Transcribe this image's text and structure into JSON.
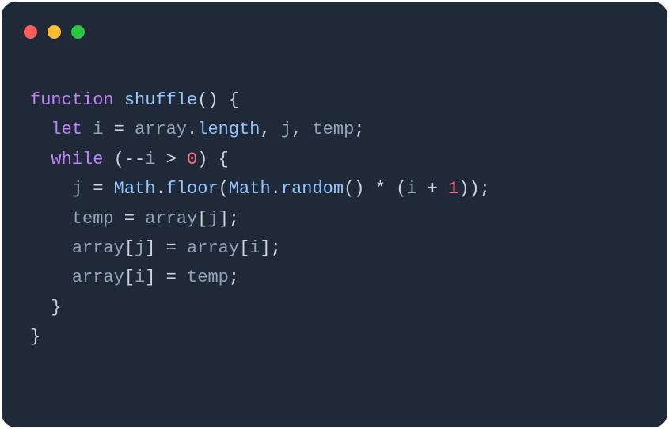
{
  "window": {
    "trafficLights": {
      "close": "#ff5f57",
      "minimize": "#febc2e",
      "zoom": "#28c840"
    }
  },
  "code": {
    "language": "javascript",
    "lines": [
      [
        {
          "t": "function ",
          "c": "keyword"
        },
        {
          "t": "shuffle",
          "c": "funcdef"
        },
        {
          "t": "()",
          "c": "punct"
        },
        {
          "t": " ",
          "c": "punct"
        },
        {
          "t": "{",
          "c": "punct"
        }
      ],
      [
        {
          "t": "  ",
          "c": "punct"
        },
        {
          "t": "let ",
          "c": "keyword"
        },
        {
          "t": "i ",
          "c": "ident"
        },
        {
          "t": "= ",
          "c": "op"
        },
        {
          "t": "array",
          "c": "ident"
        },
        {
          "t": ".",
          "c": "punct"
        },
        {
          "t": "length",
          "c": "prop"
        },
        {
          "t": ", ",
          "c": "punct"
        },
        {
          "t": "j",
          "c": "ident"
        },
        {
          "t": ", ",
          "c": "punct"
        },
        {
          "t": "temp",
          "c": "ident"
        },
        {
          "t": ";",
          "c": "punct"
        }
      ],
      [
        {
          "t": "  ",
          "c": "punct"
        },
        {
          "t": "while ",
          "c": "keyword"
        },
        {
          "t": "(",
          "c": "punct"
        },
        {
          "t": "--",
          "c": "op"
        },
        {
          "t": "i ",
          "c": "ident"
        },
        {
          "t": "> ",
          "c": "op"
        },
        {
          "t": "0",
          "c": "number"
        },
        {
          "t": ")",
          "c": "punct"
        },
        {
          "t": " ",
          "c": "punct"
        },
        {
          "t": "{",
          "c": "punct"
        }
      ],
      [
        {
          "t": "    ",
          "c": "punct"
        },
        {
          "t": "j ",
          "c": "ident"
        },
        {
          "t": "= ",
          "c": "op"
        },
        {
          "t": "Math",
          "c": "builtin"
        },
        {
          "t": ".",
          "c": "punct"
        },
        {
          "t": "floor",
          "c": "prop"
        },
        {
          "t": "(",
          "c": "punct"
        },
        {
          "t": "Math",
          "c": "builtin"
        },
        {
          "t": ".",
          "c": "punct"
        },
        {
          "t": "random",
          "c": "prop"
        },
        {
          "t": "()",
          "c": "punct"
        },
        {
          "t": " * ",
          "c": "op"
        },
        {
          "t": "(",
          "c": "punct"
        },
        {
          "t": "i ",
          "c": "ident"
        },
        {
          "t": "+ ",
          "c": "op"
        },
        {
          "t": "1",
          "c": "number"
        },
        {
          "t": "));",
          "c": "punct"
        }
      ],
      [
        {
          "t": "    ",
          "c": "punct"
        },
        {
          "t": "temp ",
          "c": "ident"
        },
        {
          "t": "= ",
          "c": "op"
        },
        {
          "t": "array",
          "c": "ident"
        },
        {
          "t": "[",
          "c": "punct"
        },
        {
          "t": "j",
          "c": "ident"
        },
        {
          "t": "];",
          "c": "punct"
        }
      ],
      [
        {
          "t": "    ",
          "c": "punct"
        },
        {
          "t": "array",
          "c": "ident"
        },
        {
          "t": "[",
          "c": "punct"
        },
        {
          "t": "j",
          "c": "ident"
        },
        {
          "t": "]",
          "c": "punct"
        },
        {
          "t": " = ",
          "c": "op"
        },
        {
          "t": "array",
          "c": "ident"
        },
        {
          "t": "[",
          "c": "punct"
        },
        {
          "t": "i",
          "c": "ident"
        },
        {
          "t": "];",
          "c": "punct"
        }
      ],
      [
        {
          "t": "    ",
          "c": "punct"
        },
        {
          "t": "array",
          "c": "ident"
        },
        {
          "t": "[",
          "c": "punct"
        },
        {
          "t": "i",
          "c": "ident"
        },
        {
          "t": "]",
          "c": "punct"
        },
        {
          "t": " = ",
          "c": "op"
        },
        {
          "t": "temp",
          "c": "ident"
        },
        {
          "t": ";",
          "c": "punct"
        }
      ],
      [
        {
          "t": "  }",
          "c": "punct"
        }
      ],
      [
        {
          "t": "}",
          "c": "punct"
        }
      ]
    ]
  }
}
